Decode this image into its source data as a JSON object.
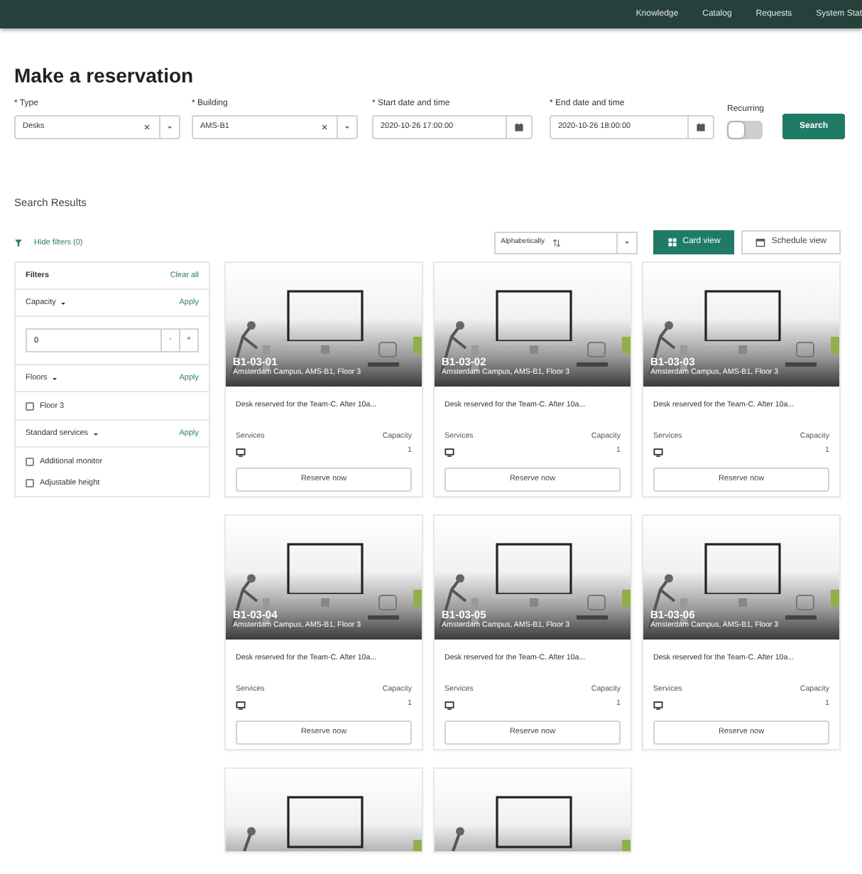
{
  "nav": {
    "links": [
      "Knowledge",
      "Catalog",
      "Requests",
      "System Stat"
    ]
  },
  "title": "Make a reservation",
  "form": {
    "fields": [
      {
        "kind": "select",
        "label": "* Type",
        "value": "Desks"
      },
      {
        "kind": "select",
        "label": "* Building",
        "value": "AMS-B1"
      },
      {
        "kind": "date",
        "label": "* Start date and time",
        "value": "2020-10-26 17:00:00"
      },
      {
        "kind": "date",
        "label": "* End date and time",
        "value": "2020-10-26 18:00:00"
      }
    ],
    "recurring": {
      "label": "Recurring",
      "on": false
    },
    "search_button": "Search"
  },
  "results": {
    "heading": "Search Results",
    "hide_filters": "Hide filters (0)",
    "sort": {
      "value": "Alphabetically"
    },
    "views": [
      {
        "label": "Card view",
        "selected": true
      },
      {
        "label": "Schedule view",
        "selected": false
      }
    ]
  },
  "filters": {
    "title": "Filters",
    "clear_all": "Clear all",
    "sections": [
      {
        "kind": "stepper",
        "title": "Capacity",
        "apply": "Apply",
        "value": "0",
        "minus": "-",
        "plus": "+"
      },
      {
        "kind": "checkboxes",
        "title": "Floors",
        "apply": "Apply",
        "options": [
          {
            "label": "Floor 3",
            "checked": false
          }
        ]
      },
      {
        "kind": "checkboxes",
        "title": "Standard services",
        "apply": "Apply",
        "options": [
          {
            "label": "Additional monitor",
            "checked": false
          },
          {
            "label": "Adjustable height",
            "checked": false
          }
        ]
      }
    ]
  },
  "cards": [
    {
      "kind": "full",
      "name": "B1-03-01",
      "location": "Amsterdam Campus, AMS-B1, Floor 3",
      "description": "Desk reserved for the Team-C. After 10a...",
      "services_label": "Services",
      "capacity_label": "Capacity",
      "capacity": "1",
      "button": "Reserve now"
    },
    {
      "kind": "full",
      "name": "B1-03-02",
      "location": "Amsterdam Campus, AMS-B1, Floor 3",
      "description": "Desk reserved for the Team-C. After 10a...",
      "services_label": "Services",
      "capacity_label": "Capacity",
      "capacity": "1",
      "button": "Reserve now"
    },
    {
      "kind": "full",
      "name": "B1-03-03",
      "location": "Amsterdam Campus, AMS-B1, Floor 3",
      "description": "Desk reserved for the Team-C. After 10a...",
      "services_label": "Services",
      "capacity_label": "Capacity",
      "capacity": "1",
      "button": "Reserve now"
    },
    {
      "kind": "full",
      "name": "B1-03-04",
      "location": "Amsterdam Campus, AMS-B1, Floor 3",
      "description": "Desk reserved for the Team-C. After 10a...",
      "services_label": "Services",
      "capacity_label": "Capacity",
      "capacity": "1",
      "button": "Reserve now"
    },
    {
      "kind": "full",
      "name": "B1-03-05",
      "location": "Amsterdam Campus, AMS-B1, Floor 3",
      "description": "Desk reserved for the Team-C. After 10a...",
      "services_label": "Services",
      "capacity_label": "Capacity",
      "capacity": "1",
      "button": "Reserve now"
    },
    {
      "kind": "full",
      "name": "B1-03-06",
      "location": "Amsterdam Campus, AMS-B1, Floor 3",
      "description": "Desk reserved for the Team-C. After 10a...",
      "services_label": "Services",
      "capacity_label": "Capacity",
      "capacity": "1",
      "button": "Reserve now"
    },
    {
      "kind": "photo_only"
    },
    {
      "kind": "photo_only"
    }
  ]
}
